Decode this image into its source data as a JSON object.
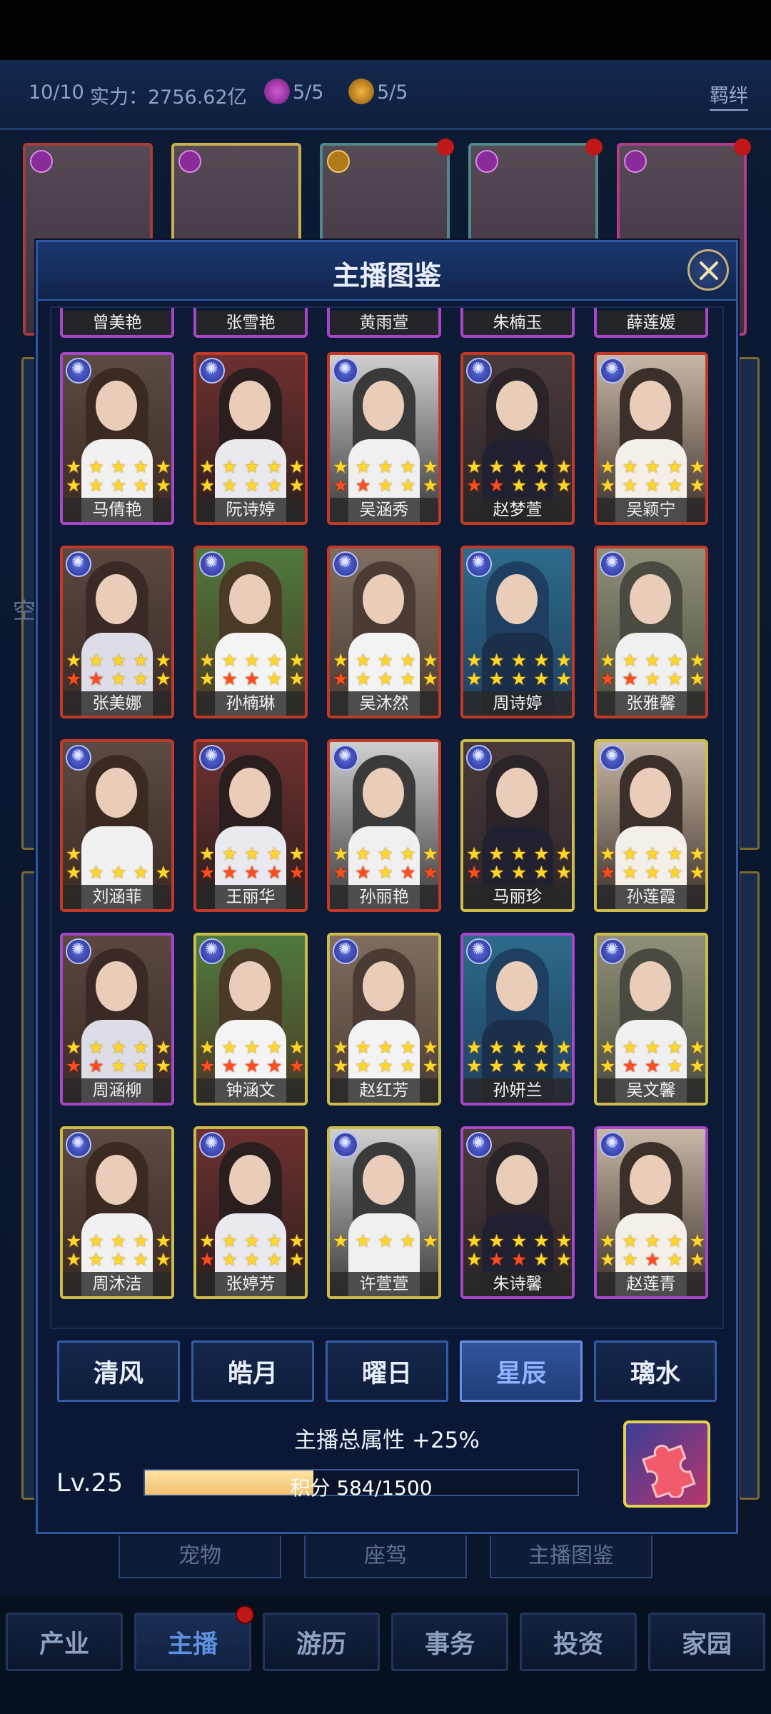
{
  "topbar": {
    "count": "10/10",
    "power": "实力：2756.62亿",
    "badge1": "5/5",
    "badge2": "5/5",
    "bond_button": "羁绊"
  },
  "modal": {
    "title": "主播图鉴",
    "partial_row_names": [
      "曾美艳",
      "张雪艳",
      "黄雨萱",
      "朱楠玉",
      "薛莲媛"
    ],
    "cards": [
      {
        "name": "马倩艳",
        "frame": "purple",
        "stars": [
          "yyyyy",
          "yyyyy"
        ]
      },
      {
        "name": "阮诗婷",
        "frame": "red",
        "stars": [
          "yyyyy",
          "yyyyy"
        ]
      },
      {
        "name": "吴涵秀",
        "frame": "red",
        "stars": [
          "yyyyy",
          "rryyy"
        ]
      },
      {
        "name": "赵梦萱",
        "frame": "red",
        "stars": [
          "yyyyy",
          "rryyy"
        ]
      },
      {
        "name": "吴颖宁",
        "frame": "red",
        "stars": [
          "yyyyy",
          "yyyyy"
        ]
      },
      {
        "name": "张美娜",
        "frame": "red",
        "stars": [
          "yyyyy",
          "rryyy"
        ]
      },
      {
        "name": "孙楠琳",
        "frame": "red",
        "stars": [
          "yyyyy",
          "yrryy"
        ]
      },
      {
        "name": "吴沐然",
        "frame": "red",
        "stars": [
          "yyyyy",
          "ryyyy"
        ]
      },
      {
        "name": "周诗婷",
        "frame": "red",
        "stars": [
          "yyyyy",
          "yyyyy"
        ]
      },
      {
        "name": "张雅馨",
        "frame": "red",
        "stars": [
          "yyyyy",
          "rryyy"
        ]
      },
      {
        "name": "刘涵菲",
        "frame": "red",
        "stars": [
          "y",
          "yyyyy"
        ]
      },
      {
        "name": "王丽华",
        "frame": "red",
        "stars": [
          "yyyyy",
          "rrrrr"
        ]
      },
      {
        "name": "孙丽艳",
        "frame": "red",
        "stars": [
          "yyyyy",
          "rryrr"
        ]
      },
      {
        "name": "马丽珍",
        "frame": "gold",
        "stars": [
          "yyyyy",
          "ryyyy"
        ]
      },
      {
        "name": "孙莲霞",
        "frame": "gold",
        "stars": [
          "yyyyy",
          "ryyyy"
        ]
      },
      {
        "name": "周涵柳",
        "frame": "purple",
        "stars": [
          "yyyyy",
          "rryyy"
        ]
      },
      {
        "name": "钟涵文",
        "frame": "gold",
        "stars": [
          "yyyyy",
          "rrrrr"
        ]
      },
      {
        "name": "赵红芳",
        "frame": "gold",
        "stars": [
          "yyyyy",
          "yyyyy"
        ]
      },
      {
        "name": "孙妍兰",
        "frame": "purple",
        "stars": [
          "yyyyy",
          "yyyyy"
        ]
      },
      {
        "name": "吴文馨",
        "frame": "gold",
        "stars": [
          "yyyyy",
          "yrryy"
        ]
      },
      {
        "name": "周沐洁",
        "frame": "gold",
        "stars": [
          "yyyyy",
          "yyyyy"
        ]
      },
      {
        "name": "张婷芳",
        "frame": "gold",
        "stars": [
          "yyyyy",
          "ryyyy"
        ]
      },
      {
        "name": "许萱萱",
        "frame": "gold",
        "stars": [
          "yyyyy",
          ""
        ]
      },
      {
        "name": "朱诗馨",
        "frame": "purple",
        "stars": [
          "yyyyy",
          "yrryy"
        ]
      },
      {
        "name": "赵莲青",
        "frame": "purple",
        "stars": [
          "yyyyy",
          "yyryy"
        ]
      }
    ],
    "tabs": [
      "清风",
      "皓月",
      "曜日",
      "星辰",
      "璃水"
    ],
    "active_tab": "星辰",
    "bonus_text": "主播总属性 +25%",
    "level": "Lv.25",
    "points_text": "积分 584/1500",
    "points_progress": 0.39
  },
  "background": {
    "side_label": "空",
    "sub_buttons": [
      "宠物",
      "座驾",
      "主播图鉴"
    ]
  },
  "bottom_nav": {
    "items": [
      "产业",
      "主播",
      "游历",
      "事务",
      "投资",
      "家园"
    ],
    "active": "主播"
  },
  "colors": {
    "frame_red": "#c23a27",
    "frame_purple": "#a646c9",
    "frame_gold": "#cdbb4a",
    "star_yellow": "#ffd72a",
    "star_red": "#ff4d1e",
    "active_tab": "#8fb3ff"
  }
}
